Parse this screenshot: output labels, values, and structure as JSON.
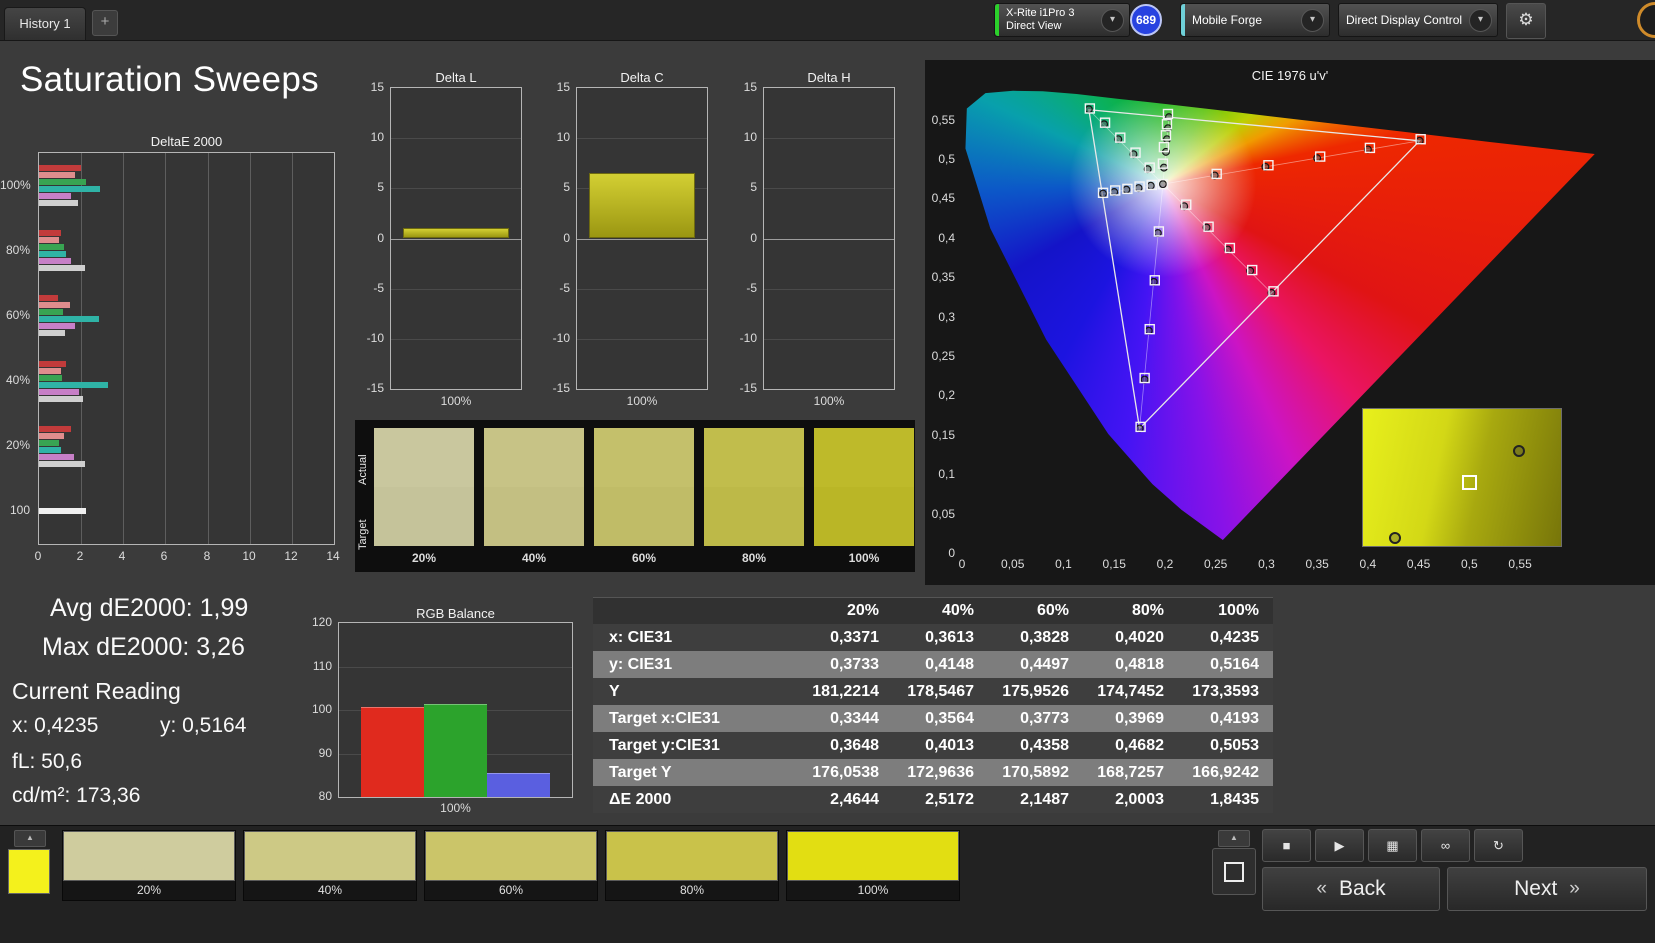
{
  "page_title": "Saturation Sweeps",
  "topbar": {
    "history_tab": "History 1",
    "add_tab": "+",
    "meter": {
      "line1": "X-Rite i1Pro 3",
      "line2": "Direct View",
      "accent": "#2bd12b"
    },
    "session_badge": "689",
    "workflow": {
      "label": "Mobile Forge",
      "accent": "#6fd0d8"
    },
    "display_control": {
      "label": "Direct Display Control",
      "accent": "#e4ea2d"
    },
    "settings_icon": "gear",
    "dropdown_icon": "chevron-down"
  },
  "stats": {
    "avg": "Avg dE2000: 1,99",
    "max": "Max dE2000: 3,26",
    "current_reading_title": "Current Reading",
    "x": "x: 0,4235",
    "y": "y: 0,5164",
    "fl": "fL: 50,6",
    "cd": "cd/m²: 173,36"
  },
  "chart_data": [
    {
      "id": "deltae2000",
      "type": "bar",
      "orientation": "horizontal",
      "title": "DeltaE 2000",
      "categories": [
        "100%",
        "80%",
        "60%",
        "40%",
        "20%",
        "100"
      ],
      "xlim": [
        0,
        14
      ],
      "xticks": [
        0,
        2,
        4,
        6,
        8,
        10,
        12,
        14
      ],
      "series_colors": [
        "#c23b3b",
        "#df8d8d",
        "#38a452",
        "#2fb3a6",
        "#c77fc7",
        "#cfcfcf"
      ],
      "groups": [
        {
          "category": "100%",
          "values": [
            2.0,
            1.7,
            2.25,
            2.9,
            1.5,
            1.85
          ]
        },
        {
          "category": "80%",
          "values": [
            1.05,
            0.95,
            1.2,
            1.3,
            1.5,
            2.2
          ]
        },
        {
          "category": "60%",
          "values": [
            0.9,
            1.45,
            1.15,
            2.85,
            1.7,
            1.25
          ]
        },
        {
          "category": "40%",
          "values": [
            1.3,
            1.05,
            1.1,
            3.26,
            1.9,
            2.1
          ]
        },
        {
          "category": "20%",
          "values": [
            1.5,
            1.2,
            0.95,
            1.05,
            1.65,
            2.2
          ]
        },
        {
          "category": "100",
          "values": [
            2.25
          ],
          "colors": [
            "#f0f0f0"
          ]
        }
      ]
    },
    {
      "id": "delta_l",
      "type": "bar",
      "title": "Delta L",
      "categories": [
        "100%"
      ],
      "values": [
        1.0
      ],
      "ylim": [
        -15,
        15
      ],
      "yticks": [
        15,
        10,
        5,
        0,
        -5,
        -10,
        -15
      ],
      "bar_color": "#b9b621"
    },
    {
      "id": "delta_c",
      "type": "bar",
      "title": "Delta C",
      "categories": [
        "100%"
      ],
      "values": [
        6.5
      ],
      "ylim": [
        -15,
        15
      ],
      "yticks": [
        15,
        10,
        5,
        0,
        -5,
        -10,
        -15
      ],
      "bar_color": "#b9b621"
    },
    {
      "id": "delta_h",
      "type": "bar",
      "title": "Delta H",
      "categories": [
        "100%"
      ],
      "values": [
        0
      ],
      "ylim": [
        -15,
        15
      ],
      "yticks": [
        15,
        10,
        5,
        0,
        -5,
        -10,
        -15
      ],
      "bar_color": "#b9b621"
    },
    {
      "id": "rgb_balance",
      "type": "bar",
      "title": "RGB Balance",
      "categories": [
        "100%"
      ],
      "ylim": [
        80,
        120
      ],
      "yticks": [
        120,
        110,
        100,
        90,
        80
      ],
      "series": [
        {
          "name": "Red",
          "value": 100.6,
          "color": "#e02a1e"
        },
        {
          "name": "Green",
          "value": 101.3,
          "color": "#2ca32c"
        },
        {
          "name": "Blue",
          "value": 85.6,
          "color": "#5a5fe0"
        }
      ]
    },
    {
      "id": "cie_diagram",
      "type": "scatter",
      "title": "CIE 1976 u'v'",
      "xlim": [
        0,
        0.68
      ],
      "ylim": [
        0,
        0.59
      ],
      "xticks": [
        {
          "v": 0,
          "label": "0"
        },
        {
          "v": 0.05,
          "label": "0,05"
        },
        {
          "v": 0.1,
          "label": "0,1"
        },
        {
          "v": 0.15,
          "label": "0,15"
        },
        {
          "v": 0.2,
          "label": "0,2"
        },
        {
          "v": 0.25,
          "label": "0,25"
        },
        {
          "v": 0.3,
          "label": "0,3"
        },
        {
          "v": 0.35,
          "label": "0,35"
        },
        {
          "v": 0.4,
          "label": "0,4"
        },
        {
          "v": 0.45,
          "label": "0,45"
        },
        {
          "v": 0.5,
          "label": "0,5"
        },
        {
          "v": 0.55,
          "label": "0,55"
        }
      ],
      "yticks": [
        {
          "v": 0,
          "label": "0"
        },
        {
          "v": 0.05,
          "label": "0,05"
        },
        {
          "v": 0.1,
          "label": "0,1"
        },
        {
          "v": 0.15,
          "label": "0,15"
        },
        {
          "v": 0.2,
          "label": "0,2"
        },
        {
          "v": 0.25,
          "label": "0,25"
        },
        {
          "v": 0.3,
          "label": "0,3"
        },
        {
          "v": 0.35,
          "label": "0,35"
        },
        {
          "v": 0.4,
          "label": "0,4"
        },
        {
          "v": 0.45,
          "label": "0,45"
        },
        {
          "v": 0.5,
          "label": "0,5"
        },
        {
          "v": 0.55,
          "label": "0,55"
        }
      ],
      "gamut_triangle": [
        [
          0.451,
          0.523
        ],
        [
          0.125,
          0.5625
        ],
        [
          0.175,
          0.158
        ]
      ],
      "white_point": [
        0.198,
        0.468
      ],
      "sweep_lines_to": [
        [
          0.451,
          0.523
        ],
        [
          0.125,
          0.5625
        ],
        [
          0.175,
          0.158
        ],
        [
          0.1385,
          0.4557
        ],
        [
          0.305,
          0.33
        ],
        [
          0.204,
          0.553
        ]
      ],
      "measured": [
        [
          0.251,
          0.481
        ],
        [
          0.302,
          0.492
        ],
        [
          0.353,
          0.503
        ],
        [
          0.402,
          0.514
        ],
        [
          0.452,
          0.525
        ],
        [
          0.185,
          0.489
        ],
        [
          0.171,
          0.508
        ],
        [
          0.156,
          0.527
        ],
        [
          0.141,
          0.546
        ],
        [
          0.126,
          0.564
        ],
        [
          0.194,
          0.408
        ],
        [
          0.19,
          0.346
        ],
        [
          0.185,
          0.284
        ],
        [
          0.18,
          0.222
        ],
        [
          0.176,
          0.16
        ],
        [
          0.187,
          0.467
        ],
        [
          0.175,
          0.465
        ],
        [
          0.163,
          0.462
        ],
        [
          0.151,
          0.46
        ],
        [
          0.139,
          0.457
        ],
        [
          0.221,
          0.442
        ],
        [
          0.243,
          0.414
        ],
        [
          0.264,
          0.387
        ],
        [
          0.286,
          0.359
        ],
        [
          0.307,
          0.332
        ],
        [
          0.198,
          0.494
        ],
        [
          0.199,
          0.515
        ],
        [
          0.201,
          0.53
        ],
        [
          0.202,
          0.544
        ],
        [
          0.203,
          0.557
        ],
        [
          0.198,
          0.468
        ]
      ],
      "targets": [
        [
          0.249,
          0.479
        ],
        [
          0.299,
          0.49
        ],
        [
          0.35,
          0.501
        ],
        [
          0.4,
          0.512
        ],
        [
          0.451,
          0.523
        ],
        [
          0.183,
          0.487
        ],
        [
          0.169,
          0.506
        ],
        [
          0.154,
          0.525
        ],
        [
          0.14,
          0.544
        ],
        [
          0.125,
          0.563
        ],
        [
          0.193,
          0.406
        ],
        [
          0.189,
          0.344
        ],
        [
          0.184,
          0.282
        ],
        [
          0.18,
          0.22
        ],
        [
          0.175,
          0.158
        ],
        [
          0.186,
          0.466
        ],
        [
          0.174,
          0.463
        ],
        [
          0.162,
          0.461
        ],
        [
          0.15,
          0.458
        ],
        [
          0.139,
          0.456
        ],
        [
          0.219,
          0.44
        ],
        [
          0.241,
          0.413
        ],
        [
          0.262,
          0.385
        ],
        [
          0.284,
          0.358
        ],
        [
          0.305,
          0.33
        ],
        [
          0.199,
          0.489
        ],
        [
          0.201,
          0.509
        ],
        [
          0.202,
          0.525
        ],
        [
          0.203,
          0.539
        ],
        [
          0.204,
          0.553
        ],
        [
          0.198,
          0.468
        ]
      ]
    },
    {
      "id": "results_table",
      "type": "table",
      "col_headers": [
        "",
        "20%",
        "40%",
        "60%",
        "80%",
        "100%"
      ],
      "rows": [
        {
          "label": "x: CIE31",
          "values": [
            "0,3371",
            "0,3613",
            "0,3828",
            "0,4020",
            "0,4235"
          ]
        },
        {
          "label": "y: CIE31",
          "values": [
            "0,3733",
            "0,4148",
            "0,4497",
            "0,4818",
            "0,5164"
          ]
        },
        {
          "label": "Y",
          "values": [
            "181,2214",
            "178,5467",
            "175,9526",
            "174,7452",
            "173,3593"
          ]
        },
        {
          "label": "Target x:CIE31",
          "values": [
            "0,3344",
            "0,3564",
            "0,3773",
            "0,3969",
            "0,4193"
          ]
        },
        {
          "label": "Target y:CIE31",
          "values": [
            "0,3648",
            "0,4013",
            "0,4358",
            "0,4682",
            "0,5053"
          ]
        },
        {
          "label": "Target Y",
          "values": [
            "176,0538",
            "172,9636",
            "170,5892",
            "168,7257",
            "166,9242"
          ]
        },
        {
          "label": "ΔE 2000",
          "values": [
            "2,4644",
            "2,5172",
            "2,1487",
            "2,0003",
            "1,8435"
          ]
        }
      ]
    }
  ],
  "swatch_panel": {
    "actual_label": "Actual",
    "target_label": "Target",
    "levels": [
      {
        "label": "20%",
        "actual": "#c9c79e",
        "target": "#c5c39a"
      },
      {
        "label": "40%",
        "actual": "#c7c386",
        "target": "#c3bf82"
      },
      {
        "label": "60%",
        "actual": "#c4c06b",
        "target": "#c0bc67"
      },
      {
        "label": "80%",
        "actual": "#c1bd4c",
        "target": "#bdb948"
      },
      {
        "label": "100%",
        "actual": "#beba2a",
        "target": "#bab626"
      }
    ]
  },
  "bottombar": {
    "current_patch_color": "#f4f11c",
    "patches": [
      {
        "label": "20%",
        "color": "#cfcc9e"
      },
      {
        "label": "40%",
        "color": "#cdc985"
      },
      {
        "label": "60%",
        "color": "#cbc569"
      },
      {
        "label": "80%",
        "color": "#c9c24a"
      },
      {
        "label": "100%",
        "color": "#e2de12"
      }
    ],
    "transport": [
      "stop",
      "play",
      "marker",
      "loop",
      "refresh"
    ],
    "back_chevron": "«",
    "back_label": "Back",
    "next_label": "Next",
    "next_chevron": "»"
  }
}
